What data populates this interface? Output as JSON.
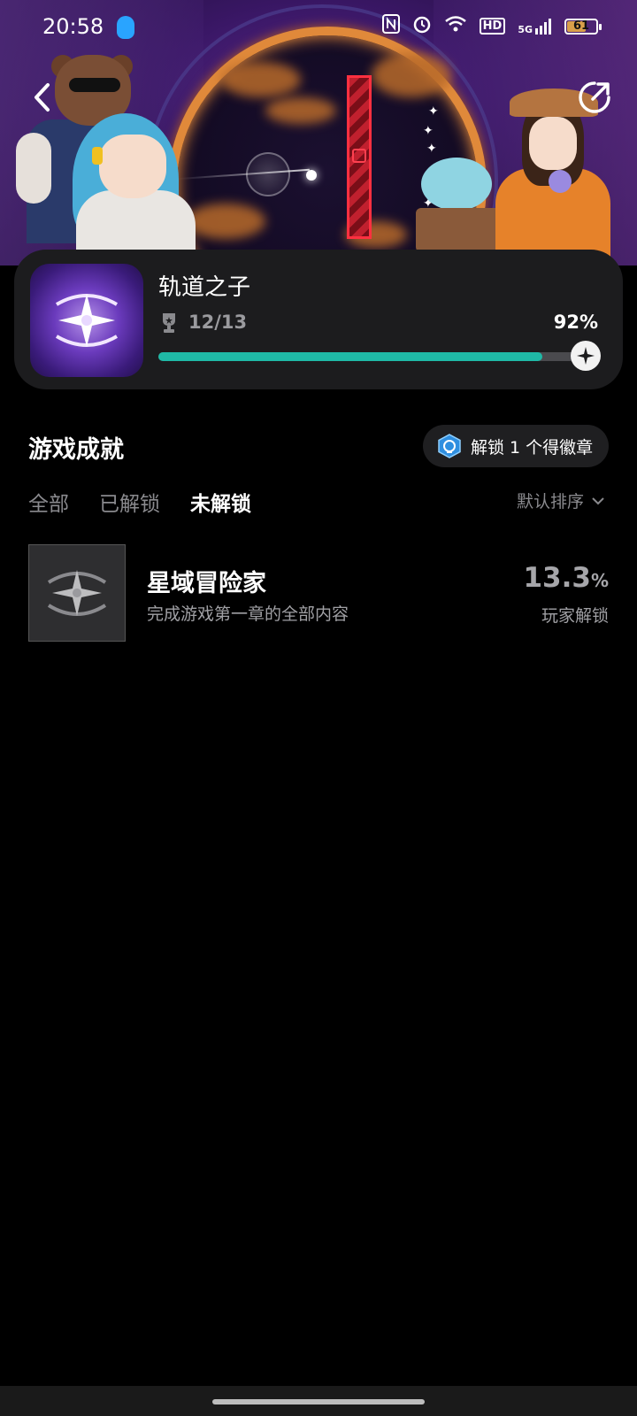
{
  "status_bar": {
    "time": "20:58",
    "icons": [
      "qq-icon",
      "nfc-icon",
      "alarm-icon",
      "wifi-icon",
      "hd-icon",
      "5g-signal-icon",
      "battery-icon"
    ],
    "hd_label": "HD",
    "network_label": "5G",
    "battery_level": "61"
  },
  "game": {
    "title": "轨道之子",
    "achievements_unlocked": "12/13",
    "progress_percent_label": "92%",
    "progress_fraction": 0.92
  },
  "section": {
    "title": "游戏成就",
    "unlock_chip_label": "解锁 1 个得徽章"
  },
  "tabs": [
    {
      "label": "全部"
    },
    {
      "label": "已解锁"
    },
    {
      "label": "未解锁"
    }
  ],
  "active_tab": "未解锁",
  "sort": {
    "label": "默认排序"
  },
  "achievements": [
    {
      "title": "星域冒险家",
      "description": "完成游戏第一章的全部内容",
      "percent": "13.3",
      "percent_unit": "%",
      "caption": "玩家解锁"
    }
  ],
  "colors": {
    "accent": "#1fb9a6",
    "card_bg": "#1c1c1e",
    "background": "#000000"
  }
}
